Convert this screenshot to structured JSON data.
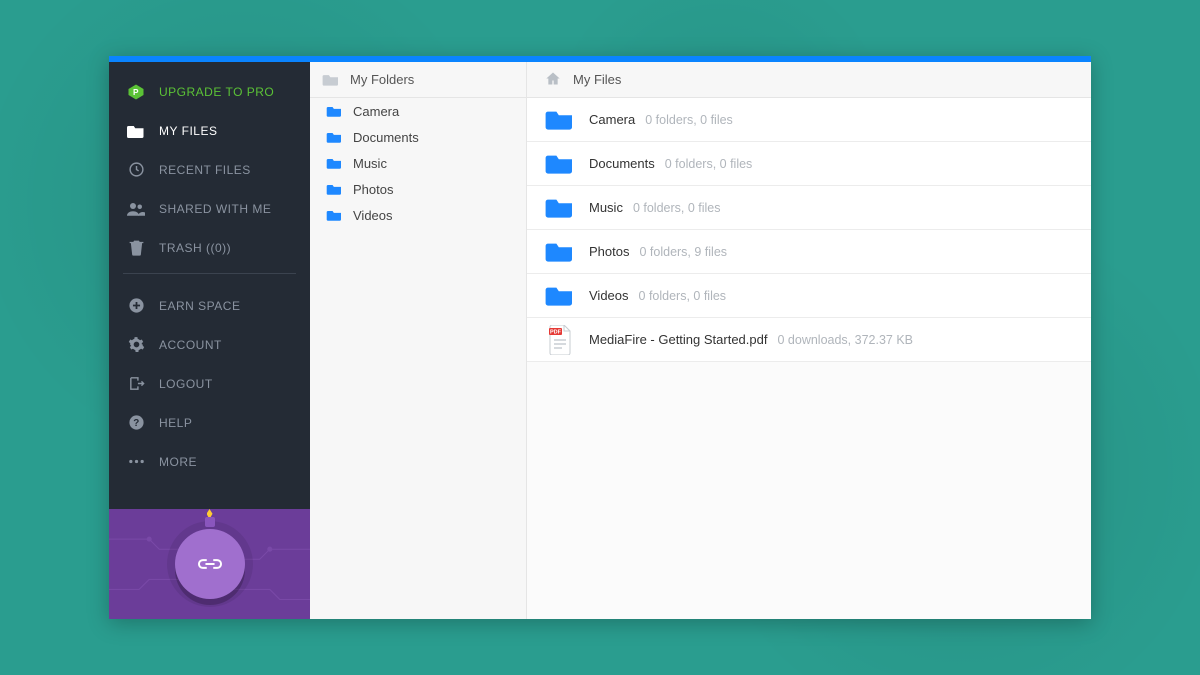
{
  "sidebar": {
    "upgrade": {
      "label": "UPGRADE TO PRO"
    },
    "items": [
      {
        "id": "myfiles",
        "label": "MY FILES",
        "icon": "folder-icon",
        "active": true
      },
      {
        "id": "recent",
        "label": "RECENT FILES",
        "icon": "clock-icon",
        "active": false
      },
      {
        "id": "shared",
        "label": "SHARED WITH ME",
        "icon": "people-icon",
        "active": false
      },
      {
        "id": "trash",
        "label": "TRASH ((0))",
        "icon": "trash-icon",
        "active": false
      }
    ],
    "secondary": [
      {
        "id": "earn",
        "label": "EARN SPACE",
        "icon": "plus-circle-icon"
      },
      {
        "id": "account",
        "label": "ACCOUNT",
        "icon": "gear-icon"
      },
      {
        "id": "logout",
        "label": "LOGOUT",
        "icon": "logout-icon"
      },
      {
        "id": "help",
        "label": "HELP",
        "icon": "help-icon"
      },
      {
        "id": "more",
        "label": "MORE",
        "icon": "more-icon"
      }
    ],
    "promo": {
      "icon": "link-icon"
    }
  },
  "tree": {
    "header": "My Folders",
    "items": [
      {
        "label": "Camera"
      },
      {
        "label": "Documents"
      },
      {
        "label": "Music"
      },
      {
        "label": "Photos"
      },
      {
        "label": "Videos"
      }
    ]
  },
  "breadcrumb": {
    "label": "My Files"
  },
  "files": [
    {
      "type": "folder",
      "name": "Camera",
      "meta": "0 folders, 0 files"
    },
    {
      "type": "folder",
      "name": "Documents",
      "meta": "0 folders, 0 files"
    },
    {
      "type": "folder",
      "name": "Music",
      "meta": "0 folders, 0 files"
    },
    {
      "type": "folder",
      "name": "Photos",
      "meta": "0 folders, 9 files"
    },
    {
      "type": "folder",
      "name": "Videos",
      "meta": "0 folders, 0 files"
    },
    {
      "type": "pdf",
      "name": "MediaFire - Getting Started.pdf",
      "meta": "0 downloads, 372.37 KB"
    }
  ],
  "colors": {
    "accent_blue": "#0a84ff",
    "folder_blue": "#1e88ff",
    "upgrade_green": "#5bc236",
    "sidebar_bg": "#242b35"
  }
}
